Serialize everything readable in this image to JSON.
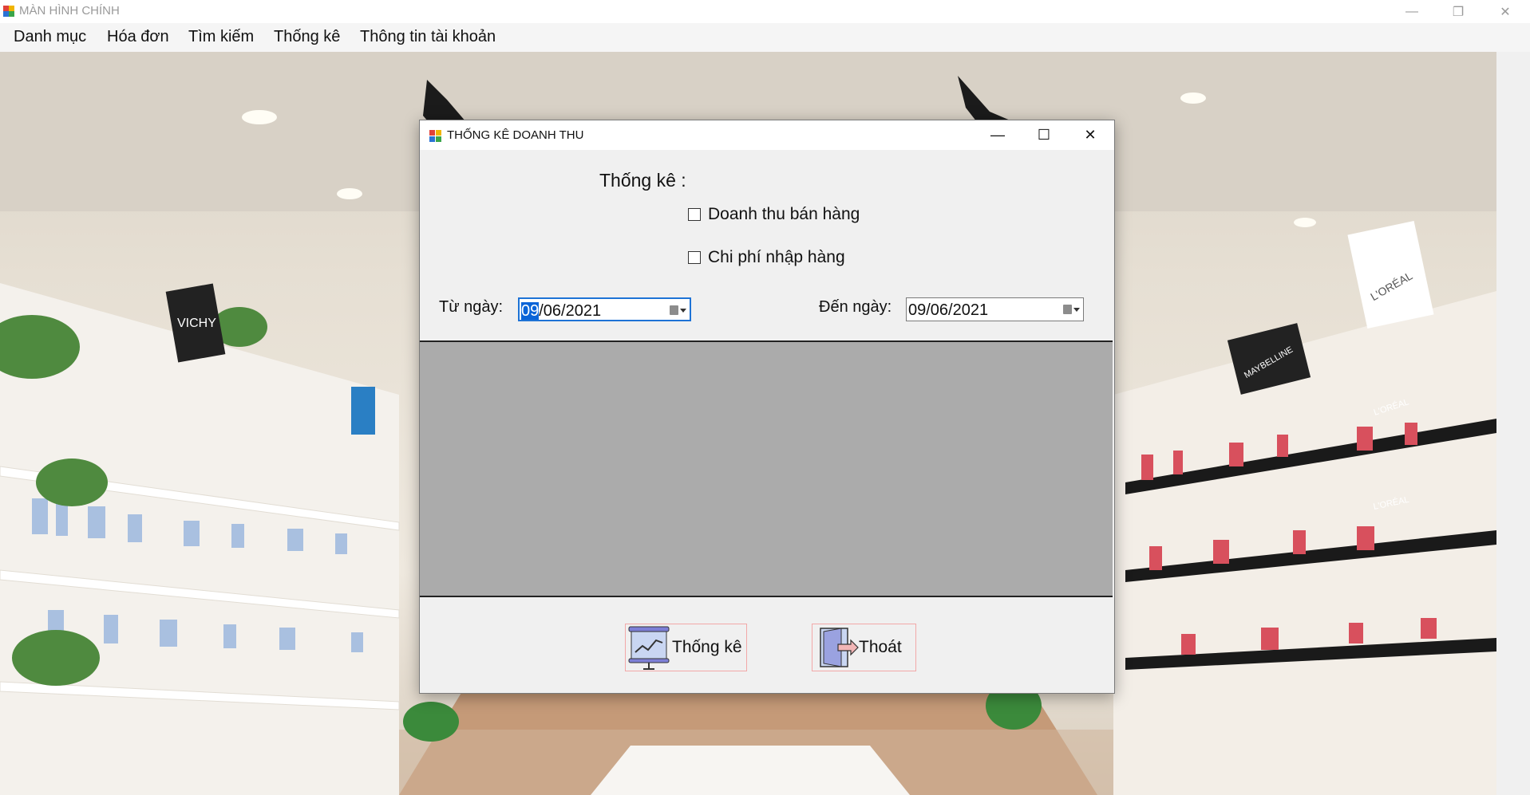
{
  "app": {
    "title": "MÀN HÌNH CHÍNH",
    "controls": {
      "minimize": "—",
      "restore": "❐",
      "close": "✕"
    }
  },
  "menu": {
    "items": [
      {
        "label": "Danh mục"
      },
      {
        "label": "Hóa đơn"
      },
      {
        "label": "Tìm kiếm"
      },
      {
        "label": "Thống kê"
      },
      {
        "label": "Thông tin tài khoản"
      }
    ]
  },
  "background": {
    "store_signs": [
      "VICHY",
      "L'ORÉAL",
      "MAYBELLINE",
      "L'ORÉAL",
      "L'ORÉAL"
    ]
  },
  "dialog": {
    "title": "THỐNG KÊ DOANH THU",
    "controls": {
      "minimize": "—",
      "maximize": "☐",
      "close": "✕"
    },
    "heading": "Thống kê :",
    "checkboxes": [
      {
        "label": "Doanh thu bán hàng",
        "checked": false
      },
      {
        "label": "Chi phí nhập hàng",
        "checked": false
      }
    ],
    "from_date": {
      "label": "Từ ngày:",
      "value_selected": "09",
      "value_rest": "/06/2021"
    },
    "to_date": {
      "label": "Đến ngày:",
      "value": "09/06/2021"
    },
    "buttons": {
      "statistics": {
        "label": "Thống kê",
        "icon": "chart-presentation-icon"
      },
      "exit": {
        "label": "Thoát",
        "icon": "exit-door-icon"
      }
    }
  },
  "colors": {
    "accent": "#1e73d6",
    "selection": "#0a64d8",
    "report_area": "#ababab",
    "button_border": "#f2a8a8"
  }
}
